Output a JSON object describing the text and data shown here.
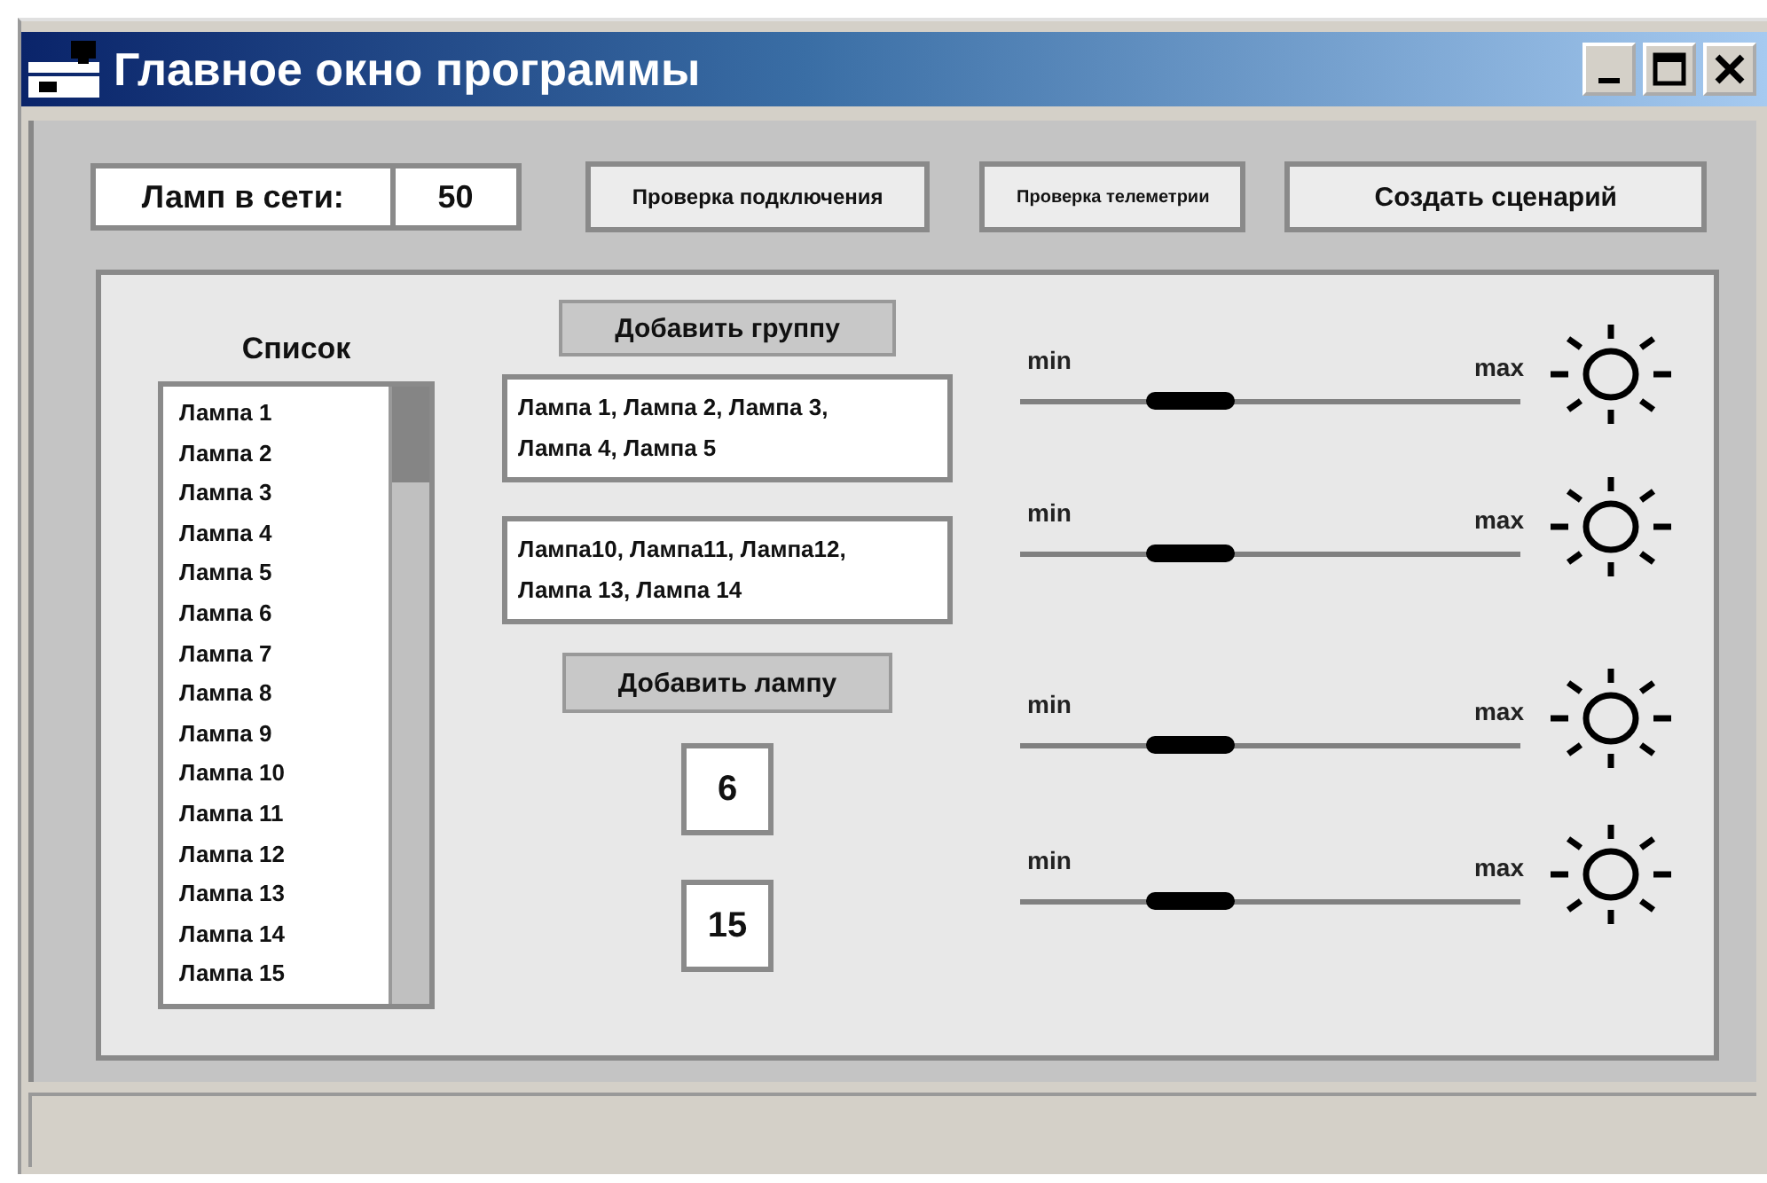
{
  "window": {
    "title": "Главное окно программы"
  },
  "top": {
    "lamps_label": "Ламп в сети:",
    "lamps_count": "50",
    "buttons": [
      "Проверка  подключения",
      "Проверка телеметрии",
      "Создать  сценарий"
    ]
  },
  "list": {
    "title": "Список",
    "items": [
      "Лампа 1",
      "Лампа 2",
      "Лампа 3",
      "Лампа 4",
      "Лампа 5",
      "Лампа 6",
      "Лампа 7",
      "Лампа 8",
      "Лампа 9",
      "Лампа 10",
      "Лампа 11",
      "Лампа 12",
      "Лампа 13",
      "Лампа 14",
      "Лампа 15"
    ]
  },
  "add_group_button": "Добавить  группу",
  "groups": [
    "Лампа 1, Лампа 2, Лампа 3, Лампа 4, Лампа 5",
    "Лампа10, Лампа11, Лампа12, Лампа 13, Лампа 14"
  ],
  "add_lamp_button": "Добавить лампу",
  "counts": [
    "6",
    "15"
  ],
  "sliders": [
    {
      "min_label": "min",
      "max_label": "max",
      "level": 0.34
    },
    {
      "min_label": "min",
      "max_label": "max",
      "level": 0.34
    },
    {
      "min_label": "min",
      "max_label": "max",
      "level": 0.34
    },
    {
      "min_label": "min",
      "max_label": "max",
      "level": 0.34
    }
  ]
}
